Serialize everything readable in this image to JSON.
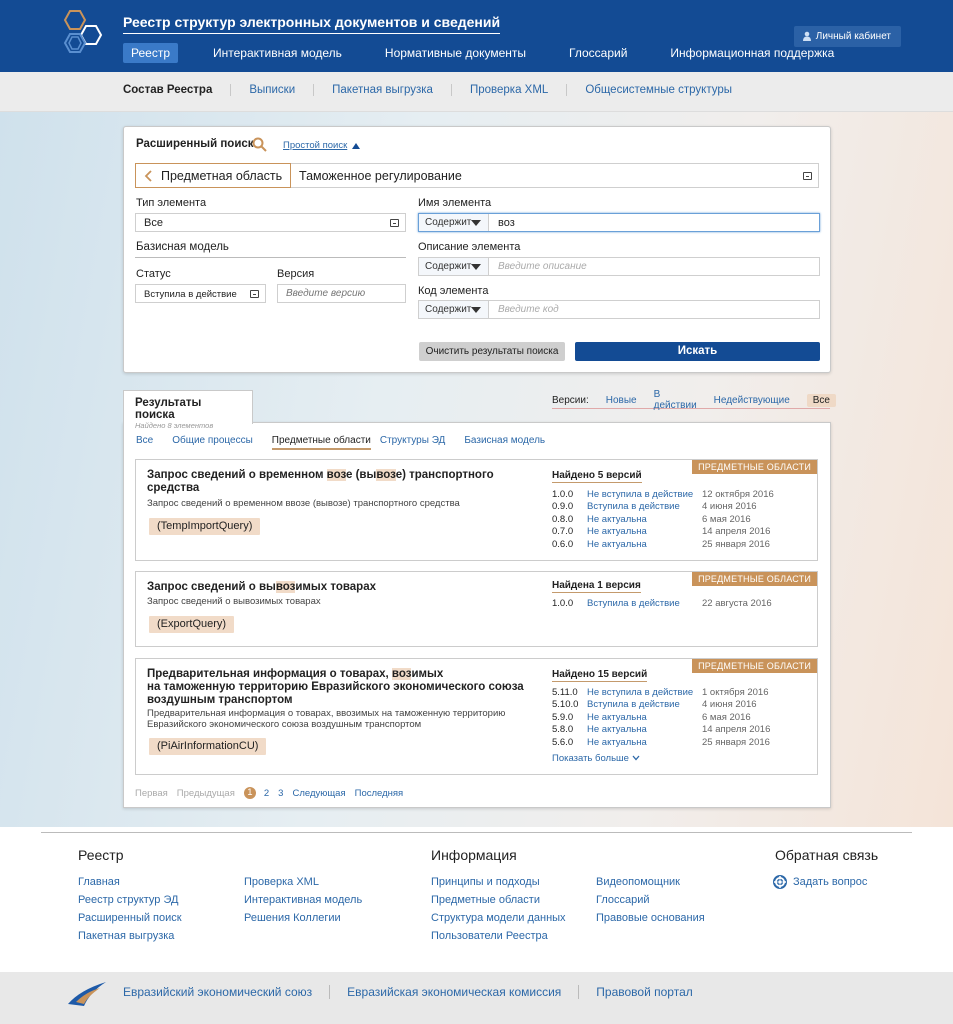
{
  "header": {
    "title": "Реестр структур электронных документов и сведений",
    "nav": [
      "Реестр",
      "Интерактивная модель",
      "Нормативные документы",
      "Глоссарий",
      "Информационная поддержка"
    ],
    "cabinet": "Личный кабинет"
  },
  "subnav": [
    "Состав Реестра",
    "Выписки",
    "Пакетная выгрузка",
    "Проверка XML",
    "Общесистемные структуры"
  ],
  "search": {
    "title": "Расширенный поиск",
    "simple_link": "Простой поиск",
    "domain_back": "Предметная область",
    "domain_value": "Таможенное регулирование",
    "type_label": "Тип элемента",
    "type_value": "Все",
    "base_model": "Базисная модель",
    "status_label": "Статус",
    "status_value": "Вступила в действие",
    "version_label": "Версия",
    "version_placeholder": "Введите версию",
    "name_label": "Имя элемента",
    "name_mode": "Содержит",
    "name_value": "воз",
    "desc_label": "Описание элемента",
    "desc_mode": "Содержит",
    "desc_placeholder": "Введите описание",
    "code_label": "Код элемента",
    "code_mode": "Содержит",
    "code_placeholder": "Введите код",
    "clear_btn": "Очистить результаты поиска",
    "search_btn": "Искать"
  },
  "results": {
    "tab_title": "Результаты поиска",
    "tab_sub": "Найдено 8 элементов",
    "versions_label": "Версии:",
    "versions": [
      "Новые",
      "В действии",
      "Недействующие",
      "Все"
    ],
    "filters": [
      "Все",
      "Общие процессы",
      "Предметные области",
      "Структуры ЭД",
      "Базисная модель"
    ],
    "badge": "ПРЕДМЕТНЫЕ ОБЛАСТИ",
    "cards": [
      {
        "title_parts": [
          "Запрос сведений о временном ",
          "воз",
          "е (вы",
          "воз",
          "е) транспортного средства"
        ],
        "desc": "Запрос сведений о временном ввозе (вывозе) транспортного средства",
        "code": "(TempImportQuery)",
        "found": "Найдено 5 версий",
        "rows": [
          {
            "n": "1.0.0",
            "st": "Не вступила в действие",
            "d": "12 октября 2016"
          },
          {
            "n": "0.9.0",
            "st": "Вступила в действие",
            "d": "4 июня 2016"
          },
          {
            "n": "0.8.0",
            "st": "Не актуальна",
            "d": "6 мая 2016"
          },
          {
            "n": "0.7.0",
            "st": "Не актуальна",
            "d": "14 апреля 2016"
          },
          {
            "n": "0.6.0",
            "st": "Не актуальна",
            "d": "25 января 2016"
          }
        ]
      },
      {
        "title_parts": [
          "Запрос сведений о вы",
          "воз",
          "имых товарах"
        ],
        "desc": "Запрос сведений о вывозимых товарах",
        "code": "(ExportQuery)",
        "found": "Найдена 1 версия",
        "rows": [
          {
            "n": "1.0.0",
            "st": "Вступила в действие",
            "d": "22 августа 2016"
          }
        ]
      },
      {
        "title_line1": [
          "Предварительная информация о товарах, ",
          "воз",
          "имых"
        ],
        "title_line2": "на таможенную территорию Евразийского экономического союза воздушным транспортом",
        "desc": "Предварительная информация о товарах, ввозимых на таможенную территорию Евразийского экономического союза воздушным транспортом",
        "code": "(PiAirInformationCU)",
        "found": "Найдено 15 версий",
        "rows": [
          {
            "n": "5.11.0",
            "st": "Не вступила в действие",
            "d": "1 октября 2016"
          },
          {
            "n": "5.10.0",
            "st": "Вступила в действие",
            "d": "4 июня 2016"
          },
          {
            "n": "5.9.0",
            "st": "Не актуальна",
            "d": "6 мая 2016"
          },
          {
            "n": "5.8.0",
            "st": "Не актуальна",
            "d": "14 апреля 2016"
          },
          {
            "n": "5.6.0",
            "st": "Не актуальна",
            "d": "25 января 2016"
          }
        ],
        "more": "Показать больше"
      }
    ],
    "pager": {
      "first": "Первая",
      "prev": "Предыдущая",
      "pages": [
        "1",
        "2",
        "3"
      ],
      "next": "Следующая",
      "last": "Последняя"
    }
  },
  "footer": {
    "col1_title": "Реестр",
    "col1a": [
      "Главная",
      "Реестр структур ЭД",
      "Расширенный поиск",
      "Пакетная выгрузка"
    ],
    "col1b": [
      "Проверка XML",
      "Интерактивная модель",
      "Решения Коллегии"
    ],
    "col2_title": "Информация",
    "col2a": [
      "Принципы и подходы",
      "Предметные области",
      "Структура модели данных",
      "Пользователи Реестра"
    ],
    "col2b": [
      "Видеопомощник",
      "Глоссарий",
      "Правовые основания"
    ],
    "col3_title": "Обратная связь",
    "col3_link": "Задать вопрос",
    "bottom": [
      "Евразийский экономический союз",
      "Евразийская экономическая комиссия",
      "Правовой портал"
    ]
  },
  "colors": {
    "header": "#134b94",
    "accent": "#c9935a",
    "highlight": "#f1dbc8",
    "link": "#2c68a8"
  }
}
